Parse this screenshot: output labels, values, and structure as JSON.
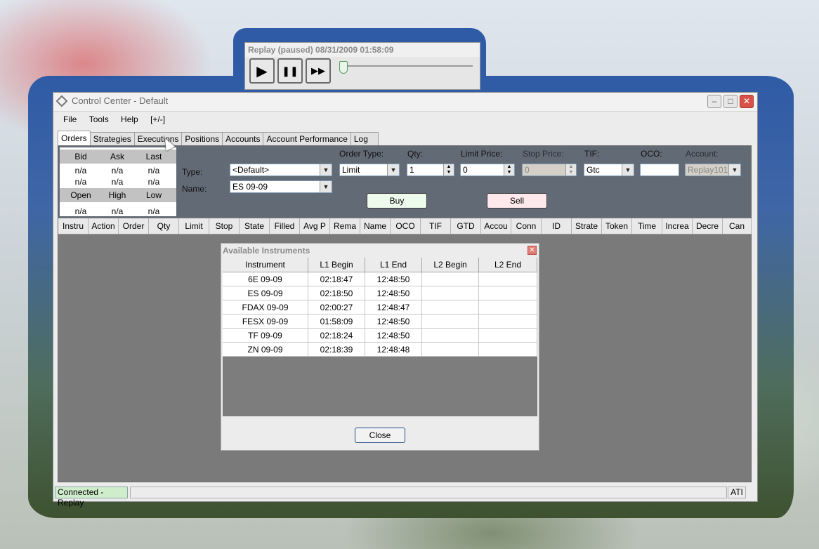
{
  "replay": {
    "title": "Replay (paused) 08/31/2009 01:58:09",
    "buttons": {
      "play": "▶",
      "pause": "❚❚",
      "fast_forward": "▶▶"
    },
    "progress": 0.0
  },
  "window": {
    "title": "Control Center - Default",
    "controls": {
      "minimize": "–",
      "maximize": "□",
      "close": "✕"
    }
  },
  "menu": [
    "File",
    "Tools",
    "Help",
    "[+/-]"
  ],
  "tabs": [
    "Orders",
    "Strategies",
    "Executions",
    "Positions",
    "Accounts",
    "Account Performance",
    "Log"
  ],
  "quote": {
    "header1": [
      "Bid",
      "Ask",
      "Last"
    ],
    "row1": [
      "n/a",
      "n/a",
      "n/a"
    ],
    "row2": [
      "n/a",
      "n/a",
      "n/a"
    ],
    "header2": [
      "Open",
      "High",
      "Low"
    ],
    "row3": [
      "n/a",
      "n/a",
      "n/a"
    ]
  },
  "order_entry": {
    "type_label": "Type:",
    "type_value": "<Default>",
    "name_label": "Name:",
    "name_value": "ES 09-09",
    "order_type_label": "Order Type:",
    "order_type_value": "Limit",
    "qty_label": "Qty:",
    "qty_value": "1",
    "limit_price_label": "Limit Price:",
    "limit_price_value": "0",
    "stop_price_label": "Stop Price:",
    "stop_price_value": "0",
    "tif_label": "TIF:",
    "tif_value": "Gtc",
    "oco_label": "OCO:",
    "oco_value": "",
    "account_label": "Account:",
    "account_value": "Replay101",
    "buy_label": "Buy",
    "sell_label": "Sell"
  },
  "order_columns": [
    "Instru",
    "Action",
    "Order",
    "Qty",
    "Limit",
    "Stop",
    "State",
    "Filled",
    "Avg P",
    "Rema",
    "Name",
    "OCO",
    "TIF",
    "GTD",
    "Accou",
    "Conn",
    "ID",
    "Strate",
    "Token",
    "Time",
    "Increa",
    "Decre",
    "Can"
  ],
  "dialog": {
    "title": "Available Instruments",
    "columns": [
      "Instrument",
      "L1 Begin",
      "L1 End",
      "L2 Begin",
      "L2 End"
    ],
    "rows": [
      [
        "6E 09-09",
        "02:18:47",
        "12:48:50",
        "",
        ""
      ],
      [
        "ES 09-09",
        "02:18:50",
        "12:48:50",
        "",
        ""
      ],
      [
        "FDAX 09-09",
        "02:00:27",
        "12:48:47",
        "",
        ""
      ],
      [
        "FESX 09-09",
        "01:58:09",
        "12:48:50",
        "",
        ""
      ],
      [
        "TF 09-09",
        "02:18:24",
        "12:48:50",
        "",
        ""
      ],
      [
        "ZN 09-09",
        "02:18:39",
        "12:48:48",
        "",
        ""
      ]
    ],
    "close_label": "Close"
  },
  "status": {
    "connection": "Connected - Replay",
    "right": "ATI"
  },
  "colors": {
    "buy_bg": "#eefaec",
    "sell_bg": "#fde8ec",
    "connected_bg": "#cfeccb",
    "orderbar_bg": "#626a75"
  }
}
